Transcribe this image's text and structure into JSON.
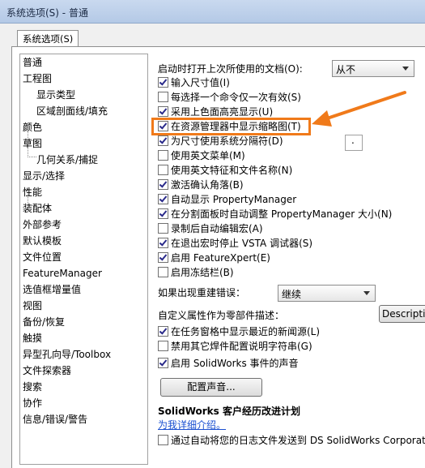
{
  "window": {
    "title": "系统选项(S) - 普通"
  },
  "tabs": [
    {
      "label": "系统选项(S)"
    }
  ],
  "sidebar": {
    "items": [
      {
        "label": "普通",
        "level": 0
      },
      {
        "label": "工程图",
        "level": 0
      },
      {
        "label": "显示类型",
        "level": 1
      },
      {
        "label": "区域剖面线/填充",
        "level": 1
      },
      {
        "label": "颜色",
        "level": 0
      },
      {
        "label": "草图",
        "level": 0
      },
      {
        "label": "几何关系/捕捉",
        "level": 1
      },
      {
        "label": "显示/选择",
        "level": 0
      },
      {
        "label": "性能",
        "level": 0
      },
      {
        "label": "装配体",
        "level": 0
      },
      {
        "label": "外部参考",
        "level": 0
      },
      {
        "label": "默认模板",
        "level": 0
      },
      {
        "label": "文件位置",
        "level": 0
      },
      {
        "label": "FeatureManager",
        "level": 0
      },
      {
        "label": "选值框增量值",
        "level": 0
      },
      {
        "label": "视图",
        "level": 0
      },
      {
        "label": "备份/恢复",
        "level": 0
      },
      {
        "label": "触摸",
        "level": 0
      },
      {
        "label": "异型孔向导/Toolbox",
        "level": 0
      },
      {
        "label": "文件探索器",
        "level": 0
      },
      {
        "label": "搜索",
        "level": 0
      },
      {
        "label": "协作",
        "level": 0
      },
      {
        "label": "信息/错误/警告",
        "level": 0
      }
    ]
  },
  "main": {
    "open_last_docs": {
      "label": "启动时打开上次所使用的文档(O):",
      "value": "从不"
    },
    "checks_a": [
      {
        "label": "输入尺寸值(I)",
        "checked": true
      },
      {
        "label": "每选择一个命令仅一次有效(S)",
        "checked": false
      },
      {
        "label": "采用上色面高亮显示(U)",
        "checked": true
      },
      {
        "label": "在资源管理器中显示缩略图(T)",
        "checked": true
      },
      {
        "label": "为尺寸使用系统分隔符(D)",
        "checked": true
      },
      {
        "label": "使用英文菜单(M)",
        "checked": false
      },
      {
        "label": "使用英文特征和文件名称(N)",
        "checked": false
      },
      {
        "label": "激活确认角落(B)",
        "checked": true
      },
      {
        "label": "自动显示 PropertyManager",
        "checked": true
      },
      {
        "label": "在分割面板时自动调整 PropertyManager 大小(N)",
        "checked": true
      },
      {
        "label": "录制后自动编辑宏(A)",
        "checked": false
      },
      {
        "label": "在退出宏时停止 VSTA 调试器(S)",
        "checked": true
      },
      {
        "label": "启用 FeatureXpert(E)",
        "checked": true
      },
      {
        "label": "启用冻结栏(B)",
        "checked": false
      }
    ],
    "separator_value": ".",
    "rebuild_error": {
      "label": "如果出现重建错误：",
      "value": "继续"
    },
    "custom_prop": {
      "label": "自定义属性作为零部件描述：",
      "value": "Descriptio"
    },
    "checks_b": [
      {
        "label": "在任务窗格中显示最近的新闻源(L)",
        "checked": true
      },
      {
        "label": "禁用其它焊件配置说明字符串(G)",
        "checked": false
      },
      {
        "label": "启用 SolidWorks 事件的声音",
        "checked": true
      }
    ],
    "sound_button": "配置声音...",
    "program_heading": "SolidWorks 客户经历改进计划",
    "program_link": "为我详细介绍。",
    "program_check": {
      "label": "通过自动将您的日志文件发送到 DS SolidWorks Corporation",
      "checked": false
    }
  },
  "annotation": {
    "color": "#f07a1a"
  }
}
